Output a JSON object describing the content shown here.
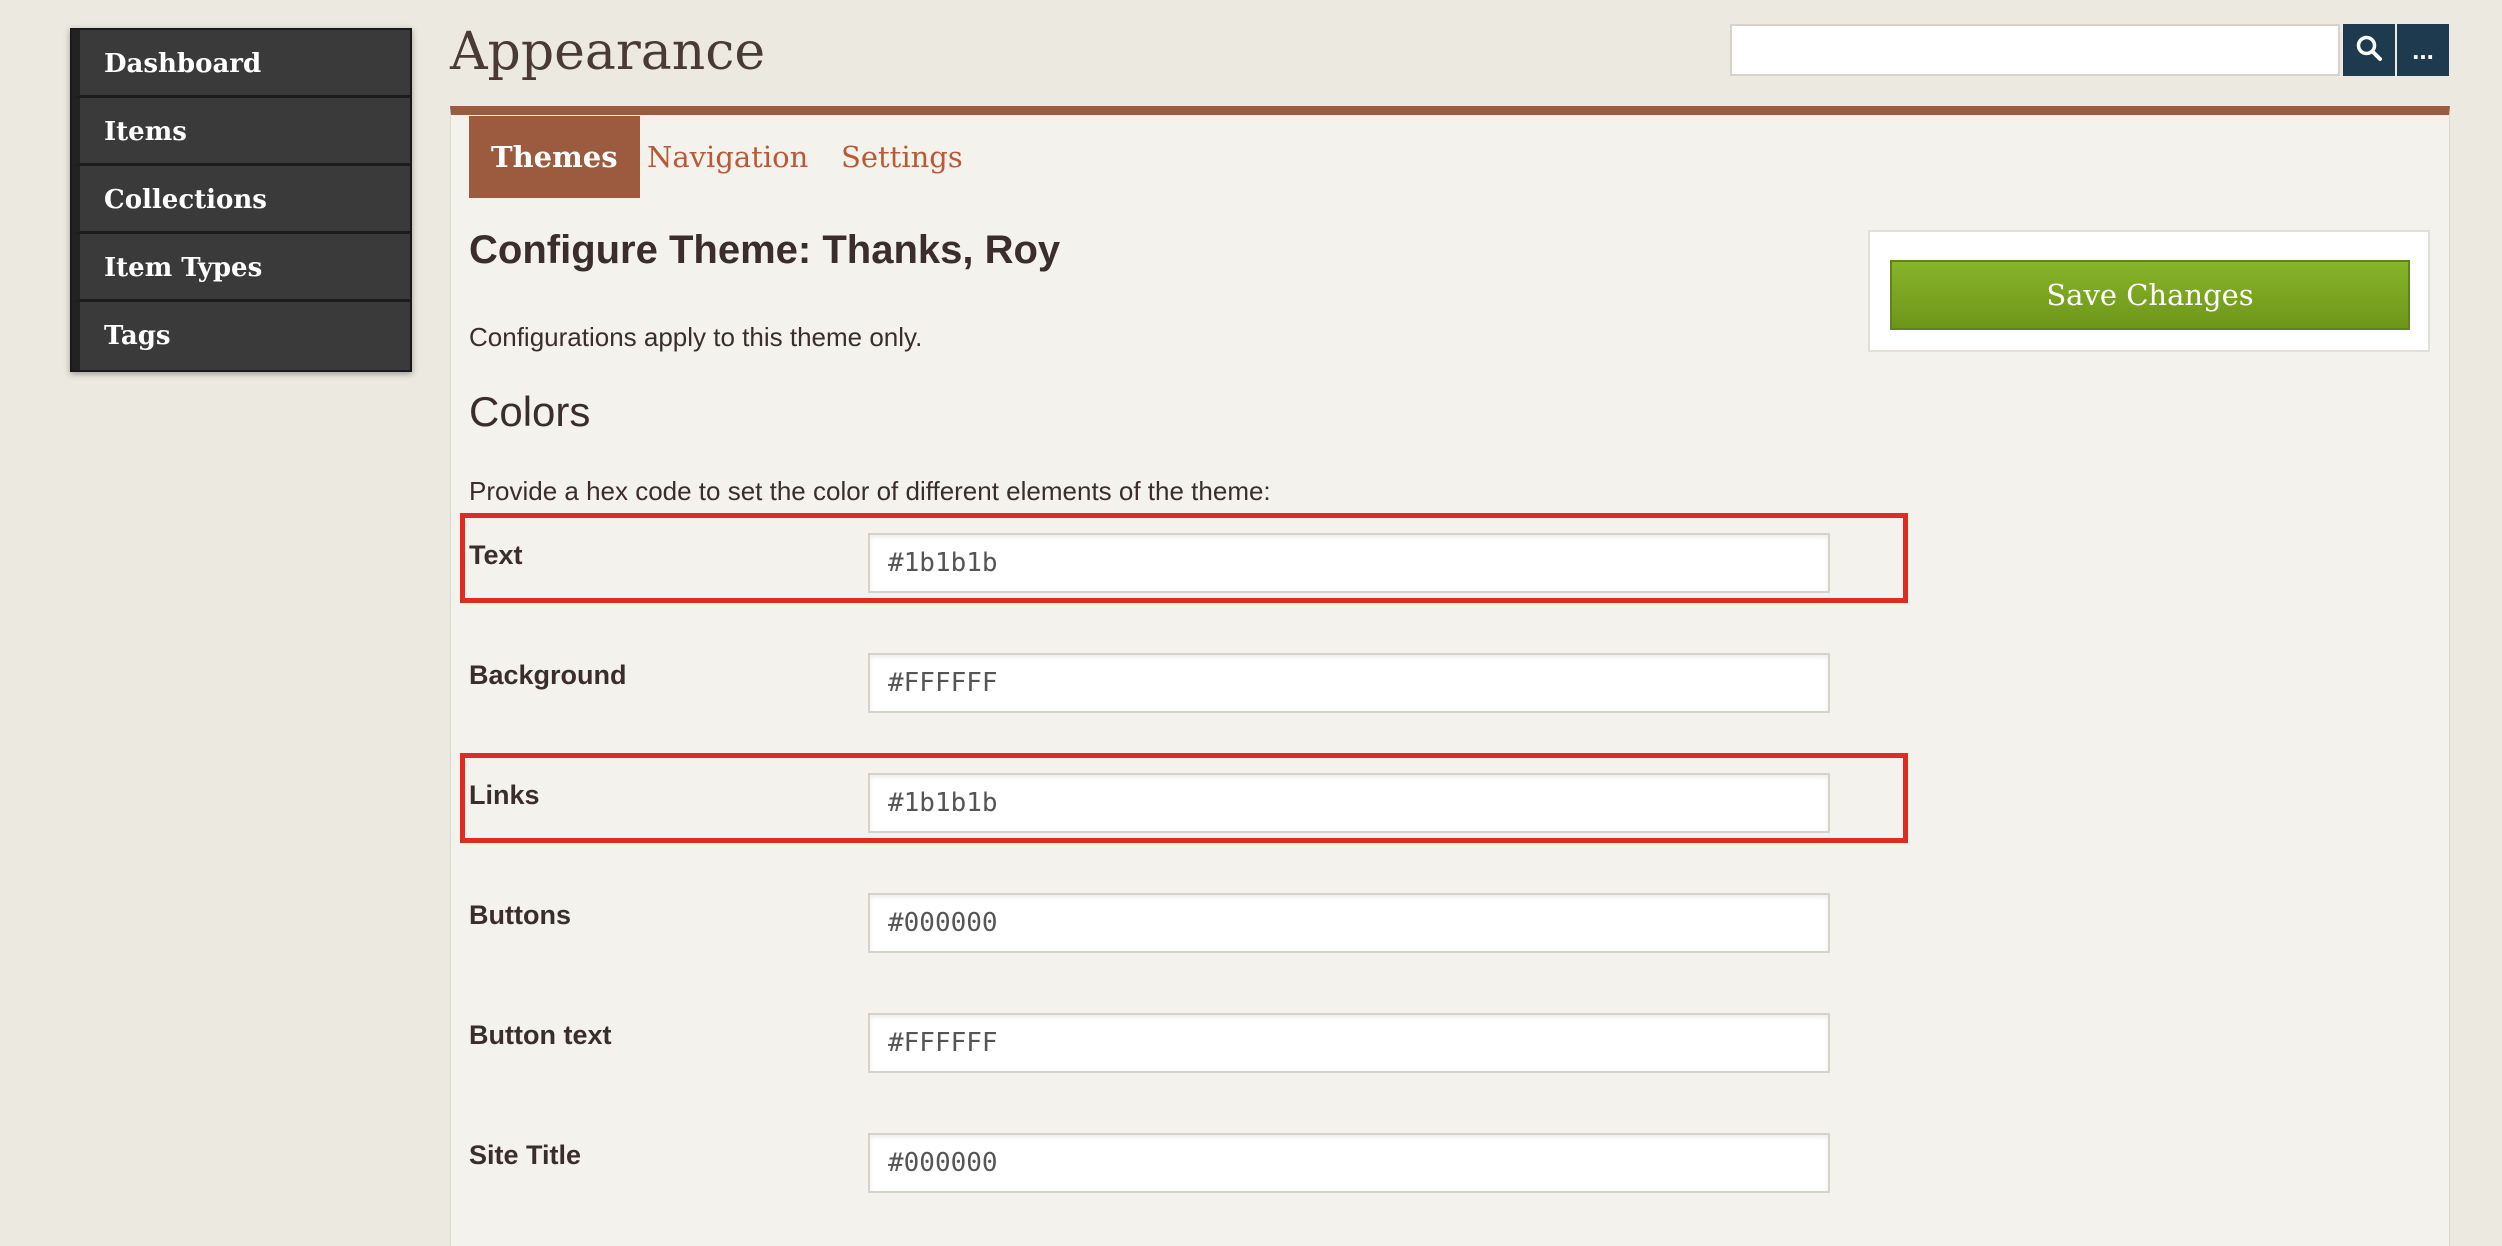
{
  "sidebar": {
    "items": [
      {
        "label": "Dashboard"
      },
      {
        "label": "Items"
      },
      {
        "label": "Collections"
      },
      {
        "label": "Item Types"
      },
      {
        "label": "Tags"
      }
    ]
  },
  "page": {
    "title": "Appearance"
  },
  "search": {
    "value": "",
    "placeholder": ""
  },
  "more": {
    "label": "..."
  },
  "tabs": [
    {
      "label": "Themes",
      "active": true
    },
    {
      "label": "Navigation",
      "active": false
    },
    {
      "label": "Settings",
      "active": false
    }
  ],
  "config": {
    "title": "Configure Theme: Thanks, Roy",
    "intro": "Configurations apply to this theme only.",
    "colors_heading": "Colors",
    "colors_desc": "Provide a hex code to set the color of different elements of the theme:"
  },
  "fields": [
    {
      "label": "Text",
      "value": "#1b1b1b",
      "highlighted": true
    },
    {
      "label": "Background",
      "value": "#FFFFFF",
      "highlighted": false
    },
    {
      "label": "Links",
      "value": "#1b1b1b",
      "highlighted": true
    },
    {
      "label": "Buttons",
      "value": "#000000",
      "highlighted": false
    },
    {
      "label": "Button text",
      "value": "#FFFFFF",
      "highlighted": false
    },
    {
      "label": "Site Title",
      "value": "#000000",
      "highlighted": false
    }
  ],
  "save": {
    "label": "Save Changes"
  },
  "colors": {
    "accent": "#9c5b3e",
    "tab_text": "#b85a35",
    "save_green": "#7aa51f",
    "search_button": "#1e3a4e",
    "highlight_red": "#e02b21"
  }
}
